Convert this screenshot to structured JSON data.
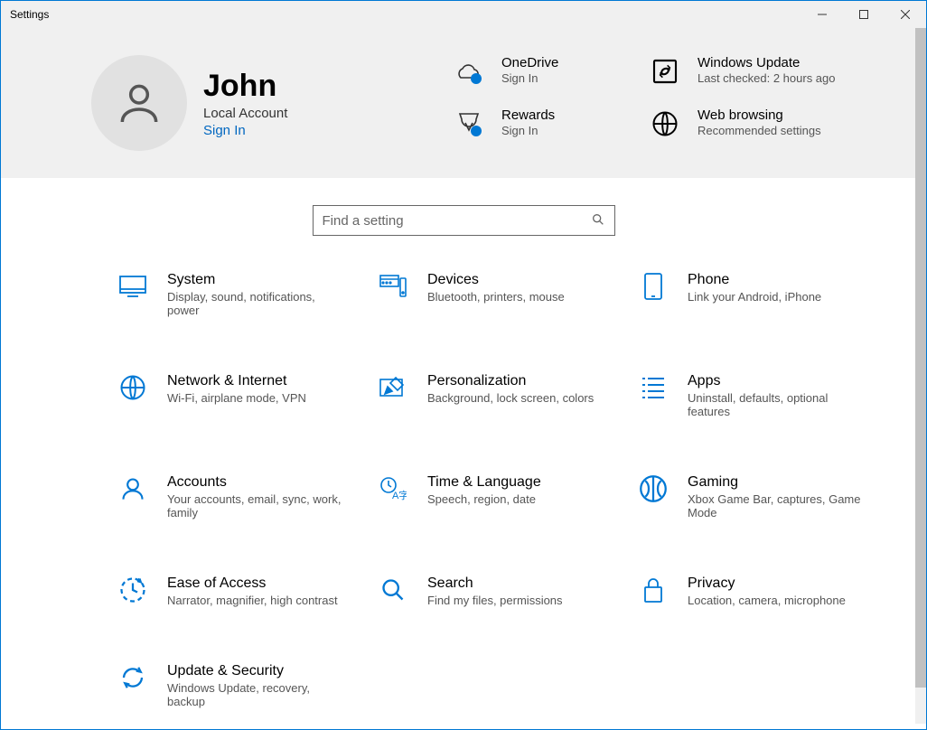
{
  "window": {
    "title": "Settings"
  },
  "profile": {
    "name": "John",
    "subtitle": "Local Account",
    "signin": "Sign In"
  },
  "summary": {
    "onedrive": {
      "title": "OneDrive",
      "sub": "Sign In"
    },
    "update": {
      "title": "Windows Update",
      "sub": "Last checked: 2 hours ago"
    },
    "rewards": {
      "title": "Rewards",
      "sub": "Sign In"
    },
    "web": {
      "title": "Web browsing",
      "sub": "Recommended settings"
    }
  },
  "search": {
    "placeholder": "Find a setting"
  },
  "cats": {
    "system": {
      "title": "System",
      "sub": "Display, sound, notifications, power"
    },
    "devices": {
      "title": "Devices",
      "sub": "Bluetooth, printers, mouse"
    },
    "phone": {
      "title": "Phone",
      "sub": "Link your Android, iPhone"
    },
    "network": {
      "title": "Network & Internet",
      "sub": "Wi-Fi, airplane mode, VPN"
    },
    "personal": {
      "title": "Personalization",
      "sub": "Background, lock screen, colors"
    },
    "apps": {
      "title": "Apps",
      "sub": "Uninstall, defaults, optional features"
    },
    "accounts": {
      "title": "Accounts",
      "sub": "Your accounts, email, sync, work, family"
    },
    "time": {
      "title": "Time & Language",
      "sub": "Speech, region, date"
    },
    "gaming": {
      "title": "Gaming",
      "sub": "Xbox Game Bar, captures, Game Mode"
    },
    "ease": {
      "title": "Ease of Access",
      "sub": "Narrator, magnifier, high contrast"
    },
    "searchc": {
      "title": "Search",
      "sub": "Find my files, permissions"
    },
    "privacy": {
      "title": "Privacy",
      "sub": "Location, camera, microphone"
    },
    "updatec": {
      "title": "Update & Security",
      "sub": "Windows Update, recovery, backup"
    }
  }
}
